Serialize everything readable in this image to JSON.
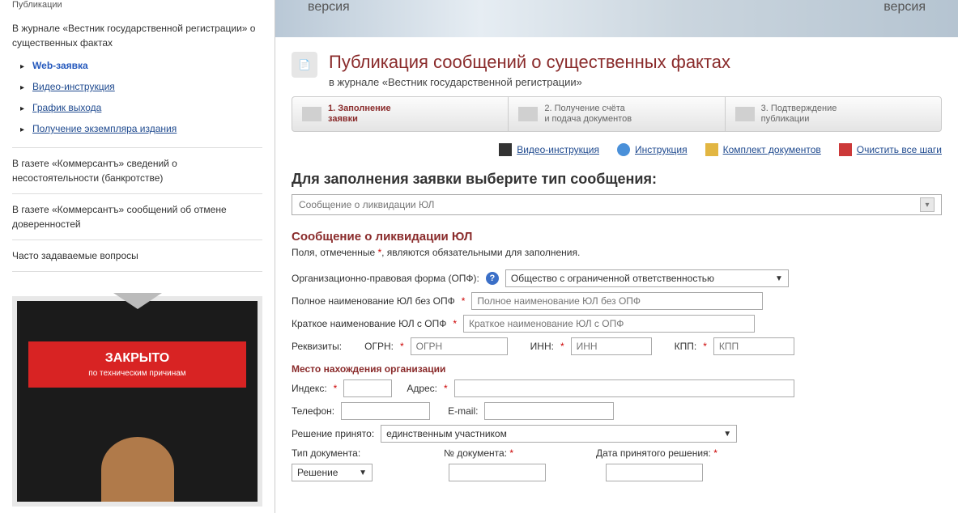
{
  "sidebar": {
    "title_cut": "Публикации",
    "group1_desc": "В журнале «Вестник государственной регистрации» о существенных фактах",
    "sub": [
      {
        "label": "Web-заявка",
        "active": true
      },
      {
        "label": "Видео-инструкция"
      },
      {
        "label": "График выхода"
      },
      {
        "label": "Получение экземпляра издания"
      }
    ],
    "group2": "В газете «Коммерсантъ» сведений о несостоятельности (банкротстве)",
    "group3": "В газете «Коммерсантъ» сообщений об отмене доверенностей",
    "group4": "Часто задаваемые вопросы",
    "closed_title": "ЗАКРЫТО",
    "closed_sub": "по техническим причинам"
  },
  "banner": {
    "left": "версия",
    "right": "версия"
  },
  "heading": {
    "title": "Публикация сообщений о существенных фактах",
    "subtitle": "в журнале «Вестник государственной регистрации»"
  },
  "steps": [
    {
      "num": "1.",
      "l1": "Заполнение",
      "l2": "заявки",
      "active": true
    },
    {
      "num": "2.",
      "l1": "Получение счёта",
      "l2": "и подача документов"
    },
    {
      "num": "3.",
      "l1": "Подтверждение",
      "l2": "публикации"
    }
  ],
  "links": {
    "video": "Видео-инструкция",
    "instr": "Инструкция",
    "pack": "Комплект документов",
    "clear": "Очистить все шаги"
  },
  "section_title": "Для заполнения заявки выберите тип сообщения:",
  "type_selected": "Сообщение о ликвидации ЮЛ",
  "msg_title": "Сообщение о ликвидации ЮЛ",
  "required_note_pre": "Поля, отмеченные ",
  "required_note_post": ", являются обязательными для заполнения.",
  "form": {
    "opf_label": "Организационно-правовая форма (ОПФ):",
    "opf_value": "Общество с ограниченной ответственностью",
    "full_name_label": "Полное наименование ЮЛ без ОПФ",
    "full_name_ph": "Полное наименование ЮЛ без ОПФ",
    "short_name_label": "Краткое наименование ЮЛ с ОПФ",
    "short_name_ph": "Краткое наименование ЮЛ с ОПФ",
    "rekv_label": "Реквизиты:",
    "ogrn_label": "ОГРН:",
    "ogrn_ph": "ОГРН",
    "inn_label": "ИНН:",
    "inn_ph": "ИНН",
    "kpp_label": "КПП:",
    "kpp_ph": "КПП",
    "loc_header": "Место нахождения организации",
    "index_label": "Индекс:",
    "addr_label": "Адрес:",
    "phone_label": "Телефон:",
    "email_label": "E-mail:",
    "decision_label": "Решение принято:",
    "decision_value": "единственным участником",
    "doc_type_label": "Тип документа:",
    "doc_type_value": "Решение",
    "doc_num_label": "№ документа:",
    "doc_date_label": "Дата принятого решения:"
  }
}
